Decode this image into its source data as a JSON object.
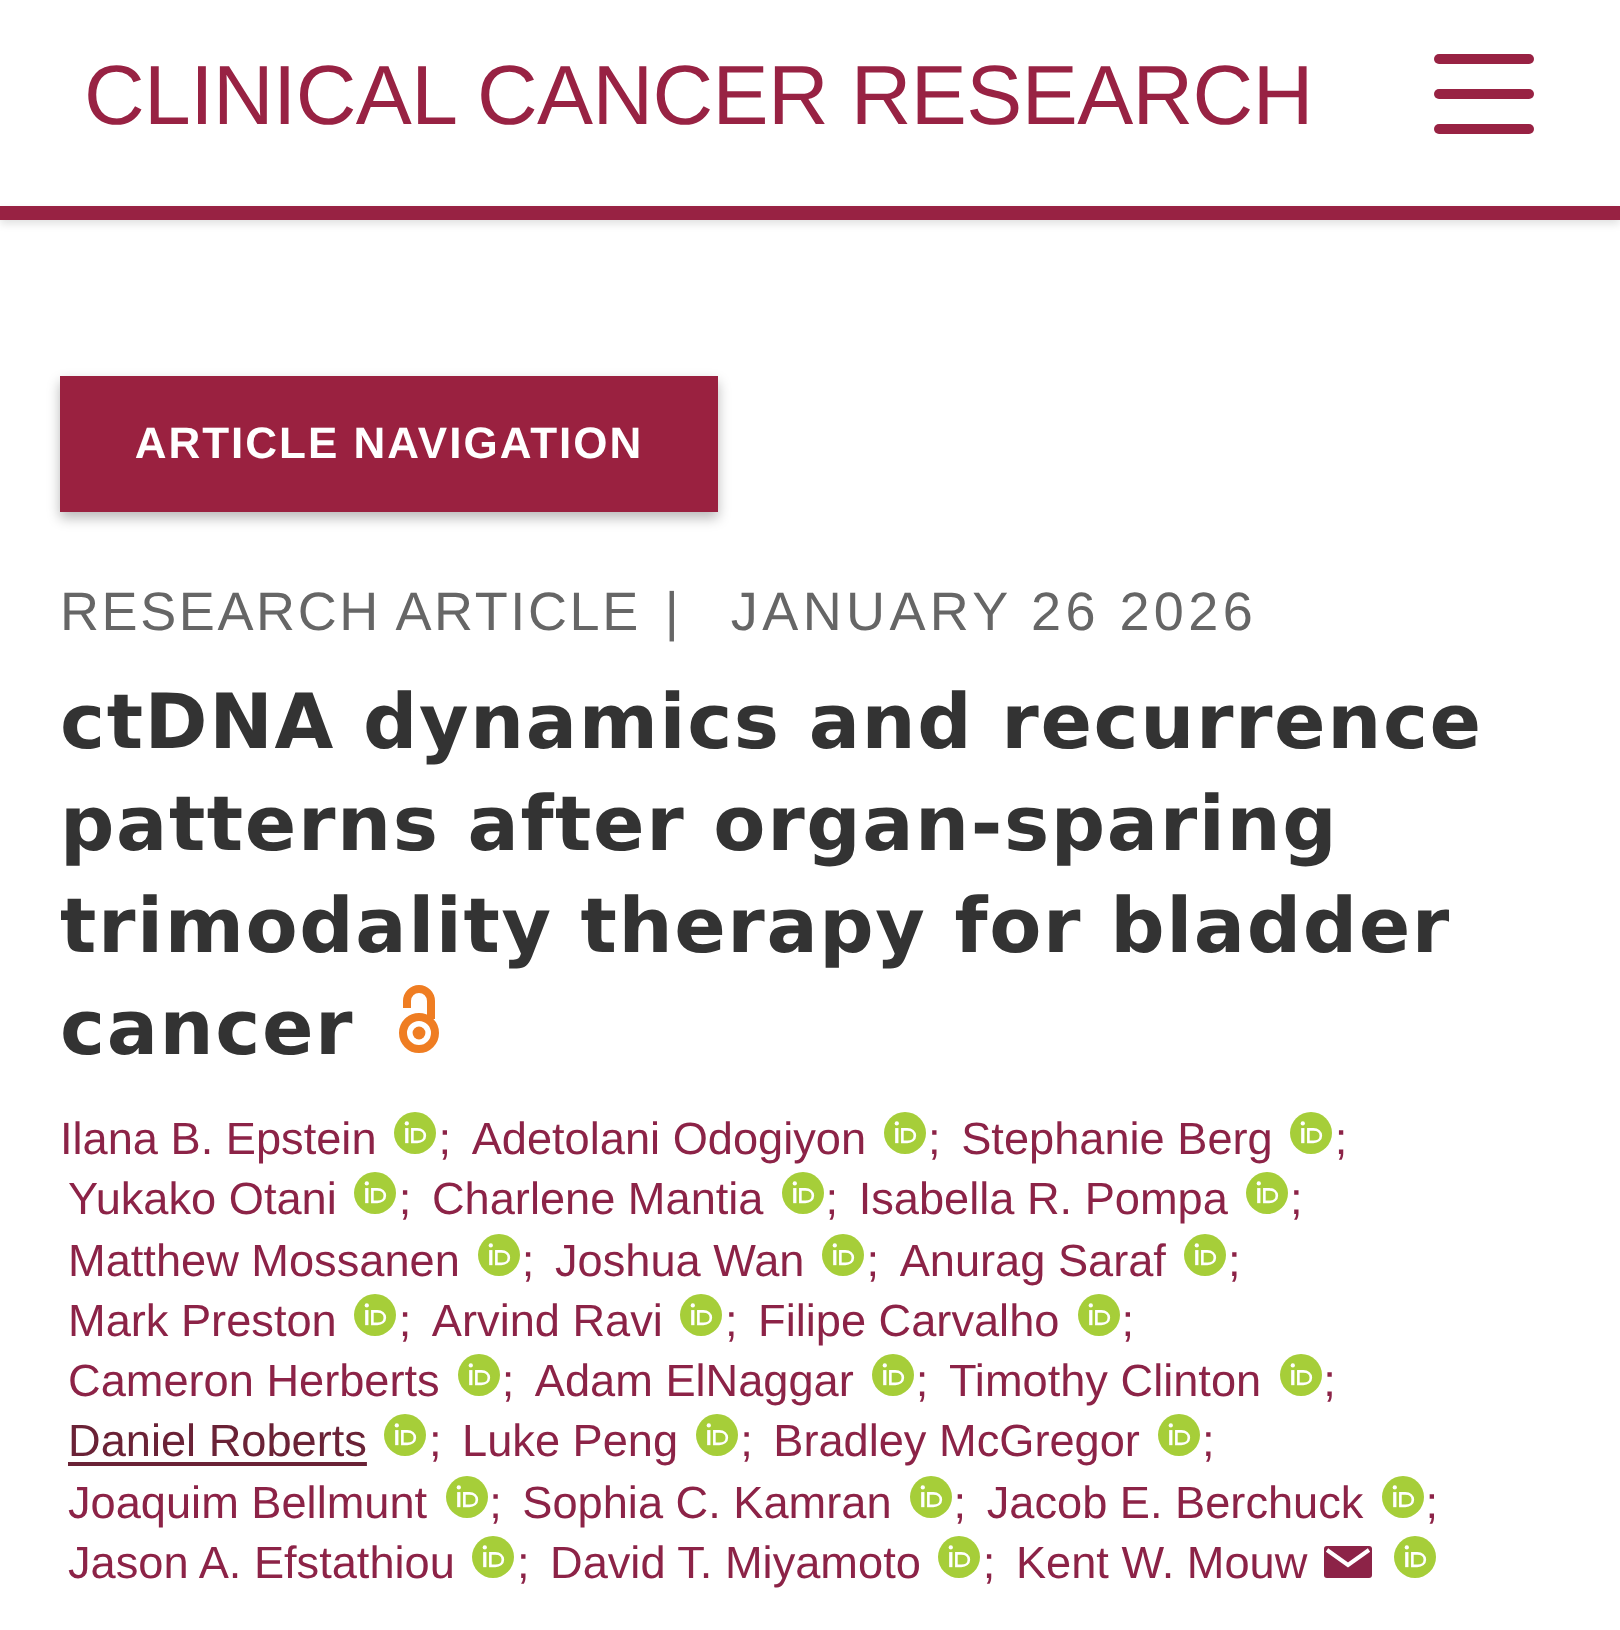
{
  "header": {
    "journal_title": "CLINICAL CANCER RESEARCH"
  },
  "navigation_button": {
    "label": "ARTICLE NAVIGATION"
  },
  "article": {
    "category": "RESEARCH ARTICLE",
    "separator": "|",
    "date": "JANUARY 26 2026",
    "title": "ctDNA dynamics and recurrence patterns after organ-sparing trimodality therapy for bladder cancer",
    "open_access": true,
    "authors": [
      {
        "name": "Ilana B. Epstein",
        "hovered": false,
        "corresponding": false,
        "separator": ";"
      },
      {
        "name": "Adetolani Odogiyon",
        "hovered": false,
        "corresponding": false,
        "separator": ";"
      },
      {
        "name": "Stephanie Berg",
        "hovered": false,
        "corresponding": false,
        "separator": ";"
      },
      {
        "name": "Yukako Otani",
        "hovered": false,
        "corresponding": false,
        "separator": ";"
      },
      {
        "name": "Charlene Mantia",
        "hovered": false,
        "corresponding": false,
        "separator": ";"
      },
      {
        "name": "Isabella R. Pompa",
        "hovered": false,
        "corresponding": false,
        "separator": ";"
      },
      {
        "name": "Matthew Mossanen",
        "hovered": false,
        "corresponding": false,
        "separator": ";"
      },
      {
        "name": "Joshua Wan",
        "hovered": false,
        "corresponding": false,
        "separator": ";"
      },
      {
        "name": "Anurag Saraf",
        "hovered": false,
        "corresponding": false,
        "separator": ";"
      },
      {
        "name": "Mark Preston",
        "hovered": false,
        "corresponding": false,
        "separator": ";"
      },
      {
        "name": "Arvind Ravi",
        "hovered": false,
        "corresponding": false,
        "separator": ";"
      },
      {
        "name": "Filipe Carvalho",
        "hovered": false,
        "corresponding": false,
        "separator": ";"
      },
      {
        "name": "Cameron Herberts",
        "hovered": false,
        "corresponding": false,
        "separator": ";"
      },
      {
        "name": "Adam ElNaggar",
        "hovered": false,
        "corresponding": false,
        "separator": ";"
      },
      {
        "name": "Timothy Clinton",
        "hovered": false,
        "corresponding": false,
        "separator": ";"
      },
      {
        "name": "Daniel Roberts",
        "hovered": true,
        "corresponding": false,
        "separator": ";"
      },
      {
        "name": "Luke Peng",
        "hovered": false,
        "corresponding": false,
        "separator": ";"
      },
      {
        "name": "Bradley McGregor",
        "hovered": false,
        "corresponding": false,
        "separator": ";"
      },
      {
        "name": "Joaquim Bellmunt",
        "hovered": false,
        "corresponding": false,
        "separator": ";"
      },
      {
        "name": "Sophia C. Kamran",
        "hovered": false,
        "corresponding": false,
        "separator": ";"
      },
      {
        "name": "Jacob E. Berchuck",
        "hovered": false,
        "corresponding": false,
        "separator": ";"
      },
      {
        "name": "Jason A. Efstathiou",
        "hovered": false,
        "corresponding": false,
        "separator": ";"
      },
      {
        "name": "David T. Miyamoto",
        "hovered": false,
        "corresponding": false,
        "separator": ";"
      },
      {
        "name": "Kent W. Mouw",
        "hovered": false,
        "corresponding": true
      }
    ]
  }
}
